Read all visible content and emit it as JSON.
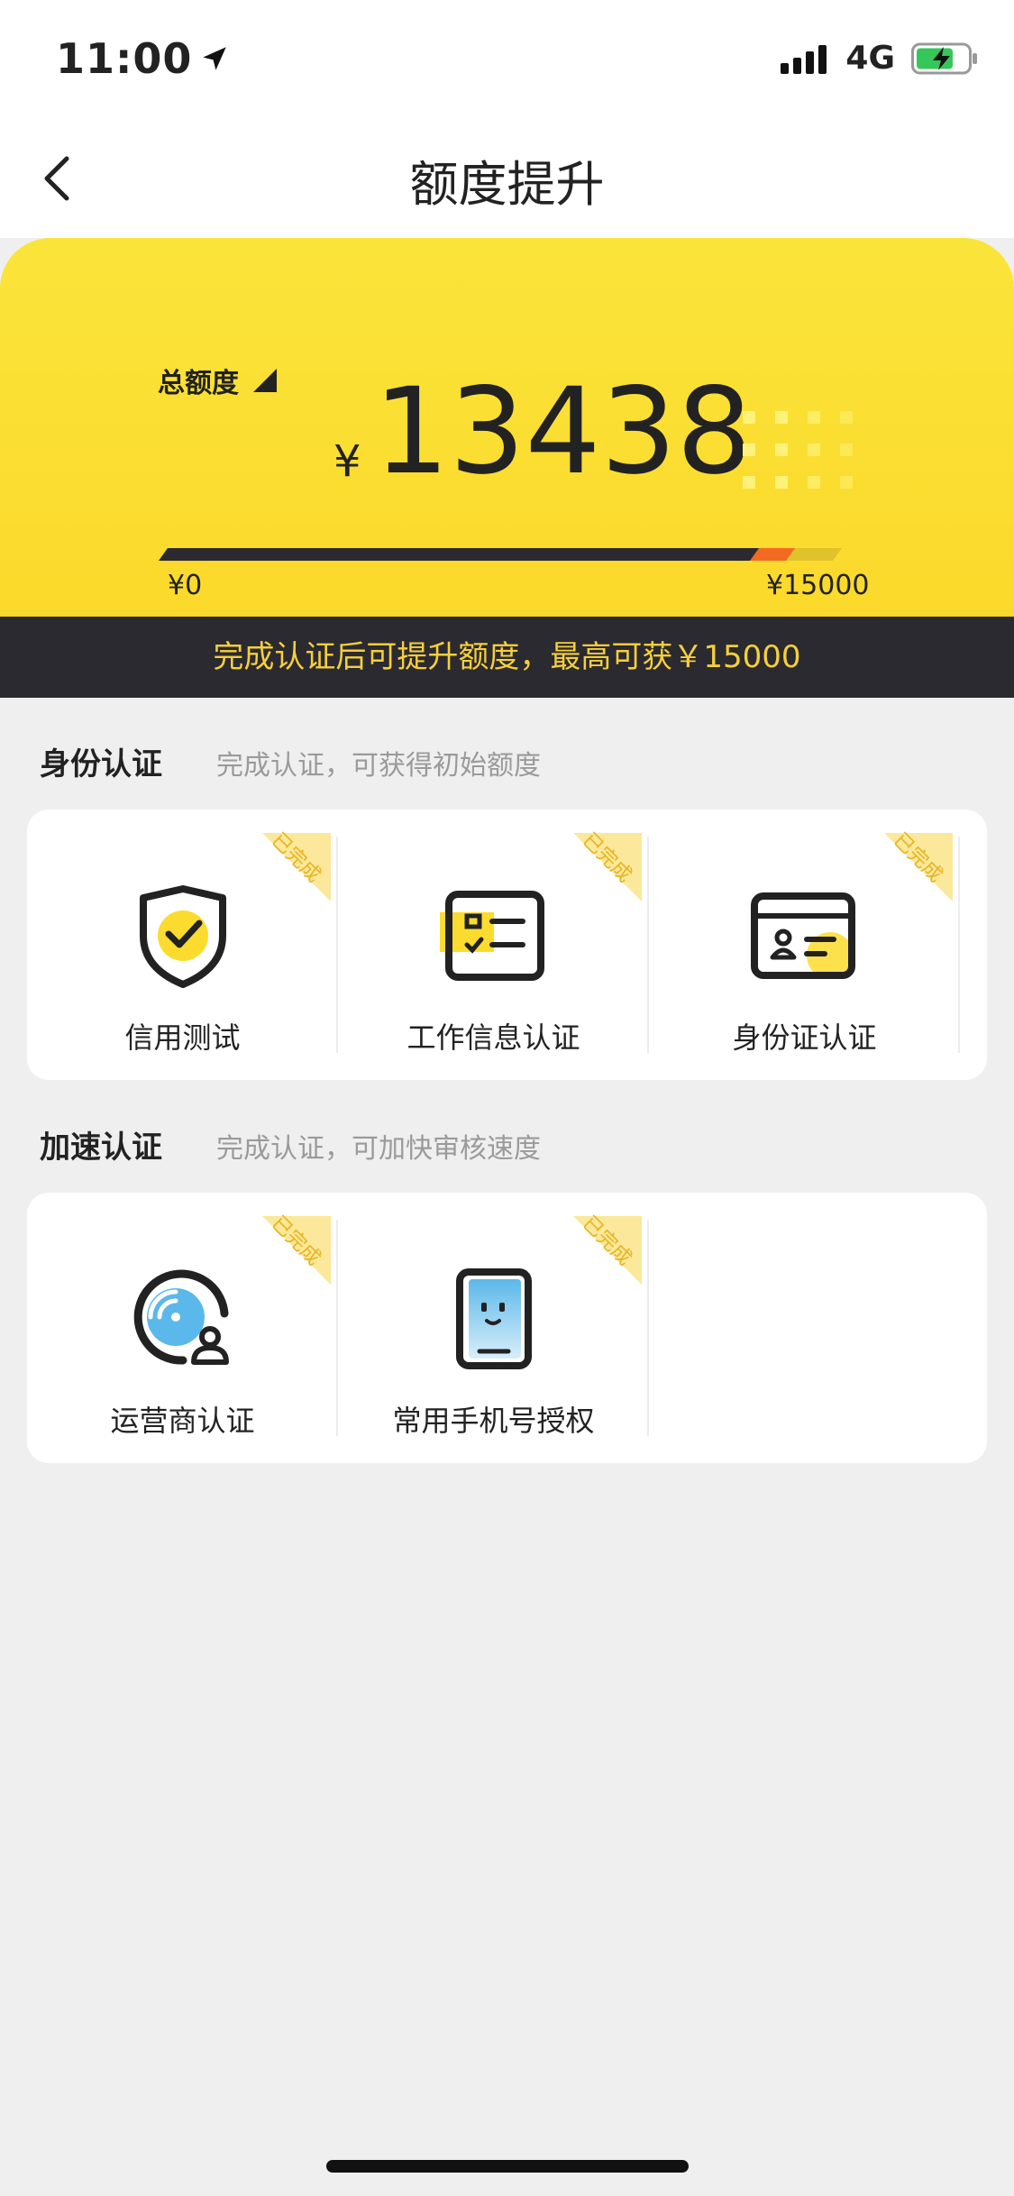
{
  "status": {
    "time": "11:00",
    "network": "4G"
  },
  "nav": {
    "title": "额度提升",
    "back_icon": "chevron-left-icon"
  },
  "quota": {
    "label": "总额度",
    "currency": "¥",
    "amount": "13438",
    "min_label": "¥0",
    "max_label": "¥15000",
    "progress": 0.896
  },
  "banner": {
    "text": "完成认证后可提升额度，最高可获￥15000"
  },
  "identity": {
    "title": "身份认证",
    "subtitle": "完成认证，可获得初始额度",
    "items": [
      {
        "label": "信用测试",
        "badge": "已完成",
        "icon": "shield-check-icon"
      },
      {
        "label": "工作信息认证",
        "badge": "已完成",
        "icon": "id-card-check-icon"
      },
      {
        "label": "身份证认证",
        "badge": "已完成",
        "icon": "identity-card-icon"
      }
    ]
  },
  "speed": {
    "title": "加速认证",
    "subtitle": "完成认证，可加快审核速度",
    "items": [
      {
        "label": "运营商认证",
        "badge": "已完成",
        "icon": "carrier-signal-icon"
      },
      {
        "label": "常用手机号授权",
        "badge": "已完成",
        "icon": "phone-icon"
      }
    ]
  },
  "colors": {
    "accent": "#fbdc2e",
    "banner_bg": "#2b2a30",
    "banner_text": "#f6cf3a",
    "progress_marker": "#f26a22"
  }
}
